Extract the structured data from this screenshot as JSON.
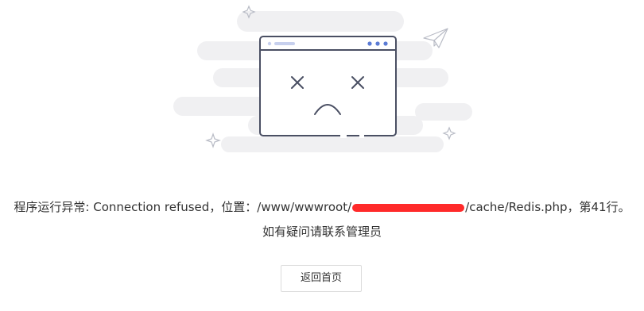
{
  "error": {
    "prefix": "程序运行异常: Connection refused，位置：/www/wwwroot/",
    "suffix": "/cache/Redis.php，第41行。"
  },
  "contact_text": "如有疑问请联系管理员",
  "back_button_label": "返回首页",
  "colors": {
    "cloud": "#f0f0f2",
    "outline": "#4a4f63",
    "accent": "#5b7bd5",
    "redaction": "#ff2a2a"
  },
  "icons": [
    "broken-browser-icon",
    "paper-plane-icon",
    "sparkle-icon",
    "sad-face-icon"
  ]
}
